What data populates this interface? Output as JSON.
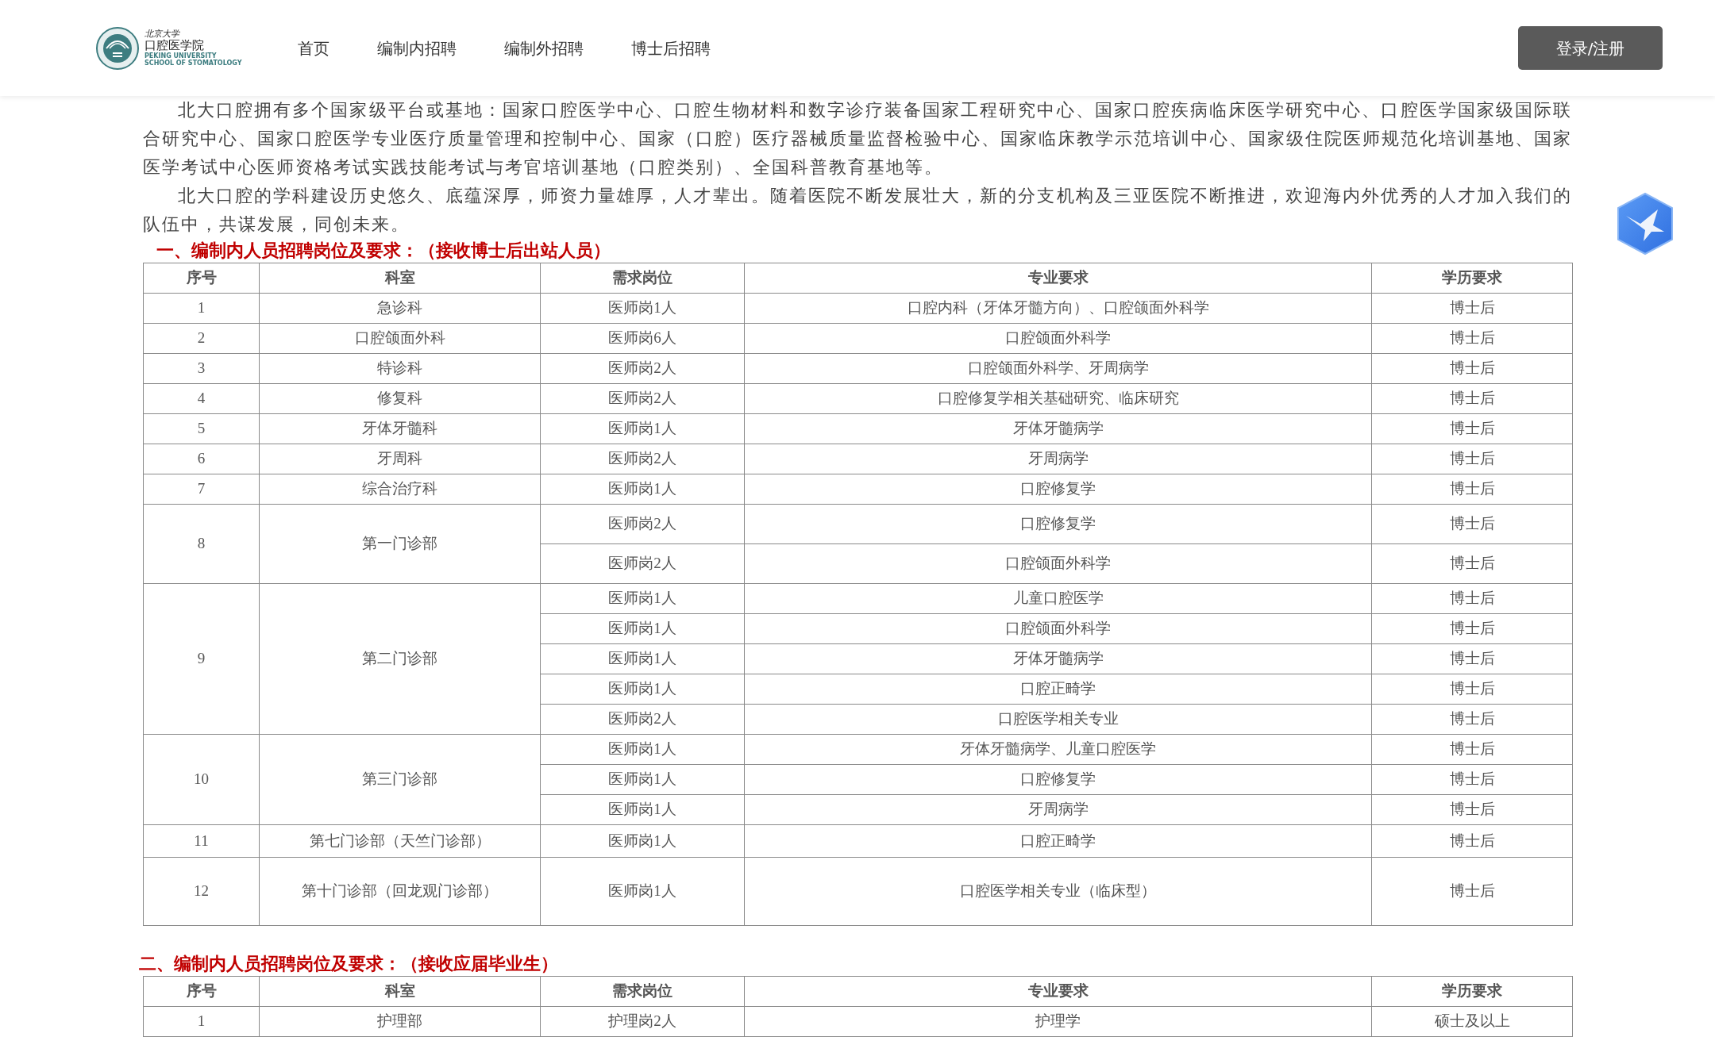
{
  "header": {
    "logo": {
      "line_1": "北京大学",
      "line_2": "口腔医学院",
      "line_3": "PEKING UNIVERSITY",
      "line_4": "SCHOOL OF STOMATOLOGY"
    },
    "nav": [
      {
        "label": "首页"
      },
      {
        "label": "编制内招聘"
      },
      {
        "label": "编制外招聘"
      },
      {
        "label": "博士后招聘"
      }
    ],
    "login_button": "登录/注册"
  },
  "intro": [
    "北大口腔拥有多个国家级平台或基地：国家口腔医学中心、口腔生物材料和数字诊疗装备国家工程研究中心、国家口腔疾病临床医学研究中心、口腔医学国家级国际联合研究中心、国家口腔医学专业医疗质量管理和控制中心、国家（口腔）医疗器械质量监督检验中心、国家临床教学示范培训中心、国家级住院医师规范化培训基地、国家医学考试中心医师资格考试实践技能考试与考官培训基地（口腔类别）、全国科普教育基地等。",
    "北大口腔的学科建设历史悠久、底蕴深厚，师资力量雄厚，人才辈出。随着医院不断发展壮大，新的分支机构及三亚医院不断推进，欢迎海内外优秀的人才加入我们的队伍中，共谋发展，同创未来。"
  ],
  "sections": [
    {
      "heading": "一、编制内人员招聘岗位及要求：（接收博士后出站人员）",
      "columns": [
        "序号",
        "科室",
        "需求岗位",
        "专业要求",
        "学历要求"
      ],
      "rows": [
        {
          "no": "1",
          "dept": "急诊科",
          "positions": [
            {
              "post": "医师岗1人",
              "major": "口腔内科（牙体牙髓方向）、口腔颌面外科学",
              "degree": "博士后"
            }
          ]
        },
        {
          "no": "2",
          "dept": "口腔颌面外科",
          "positions": [
            {
              "post": "医师岗6人",
              "major": "口腔颌面外科学",
              "degree": "博士后"
            }
          ]
        },
        {
          "no": "3",
          "dept": "特诊科",
          "positions": [
            {
              "post": "医师岗2人",
              "major": "口腔颌面外科学、牙周病学",
              "degree": "博士后"
            }
          ]
        },
        {
          "no": "4",
          "dept": "修复科",
          "positions": [
            {
              "post": "医师岗2人",
              "major": "口腔修复学相关基础研究、临床研究",
              "degree": "博士后"
            }
          ]
        },
        {
          "no": "5",
          "dept": "牙体牙髓科",
          "positions": [
            {
              "post": "医师岗1人",
              "major": "牙体牙髓病学",
              "degree": "博士后"
            }
          ]
        },
        {
          "no": "6",
          "dept": "牙周科",
          "positions": [
            {
              "post": "医师岗2人",
              "major": "牙周病学",
              "degree": "博士后"
            }
          ]
        },
        {
          "no": "7",
          "dept": "综合治疗科",
          "positions": [
            {
              "post": "医师岗1人",
              "major": "口腔修复学",
              "degree": "博士后"
            }
          ]
        },
        {
          "no": "8",
          "dept": "第一门诊部",
          "positions": [
            {
              "post": "医师岗2人",
              "major": "口腔修复学",
              "degree": "博士后"
            },
            {
              "post": "医师岗2人",
              "major": "口腔颌面外科学",
              "degree": "博士后"
            }
          ]
        },
        {
          "no": "9",
          "dept": "第二门诊部",
          "positions": [
            {
              "post": "医师岗1人",
              "major": "儿童口腔医学",
              "degree": "博士后"
            },
            {
              "post": "医师岗1人",
              "major": "口腔颌面外科学",
              "degree": "博士后"
            },
            {
              "post": "医师岗1人",
              "major": "牙体牙髓病学",
              "degree": "博士后"
            },
            {
              "post": "医师岗1人",
              "major": "口腔正畸学",
              "degree": "博士后"
            },
            {
              "post": "医师岗2人",
              "major": "口腔医学相关专业",
              "degree": "博士后"
            }
          ]
        },
        {
          "no": "10",
          "dept": "第三门诊部",
          "positions": [
            {
              "post": "医师岗1人",
              "major": "牙体牙髓病学、儿童口腔医学",
              "degree": "博士后"
            },
            {
              "post": "医师岗1人",
              "major": "口腔修复学",
              "degree": "博士后"
            },
            {
              "post": "医师岗1人",
              "major": "牙周病学",
              "degree": "博士后"
            }
          ]
        },
        {
          "no": "11",
          "dept": "第七门诊部（天竺门诊部）",
          "positions": [
            {
              "post": "医师岗1人",
              "major": "口腔正畸学",
              "degree": "博士后"
            }
          ]
        },
        {
          "no": "12",
          "dept": "第十门诊部（回龙观门诊部）",
          "positions": [
            {
              "post": "医师岗1人",
              "major": "口腔医学相关专业（临床型）",
              "degree": "博士后"
            }
          ]
        }
      ]
    },
    {
      "heading": "二、编制内人员招聘岗位及要求：（接收应届毕业生）",
      "columns": [
        "序号",
        "科室",
        "需求岗位",
        "专业要求",
        "学历要求"
      ],
      "rows": [
        {
          "no": "1",
          "dept": "护理部",
          "positions": [
            {
              "post": "护理岗2人",
              "major": "护理学",
              "degree": "硕士及以上"
            }
          ]
        }
      ]
    }
  ]
}
